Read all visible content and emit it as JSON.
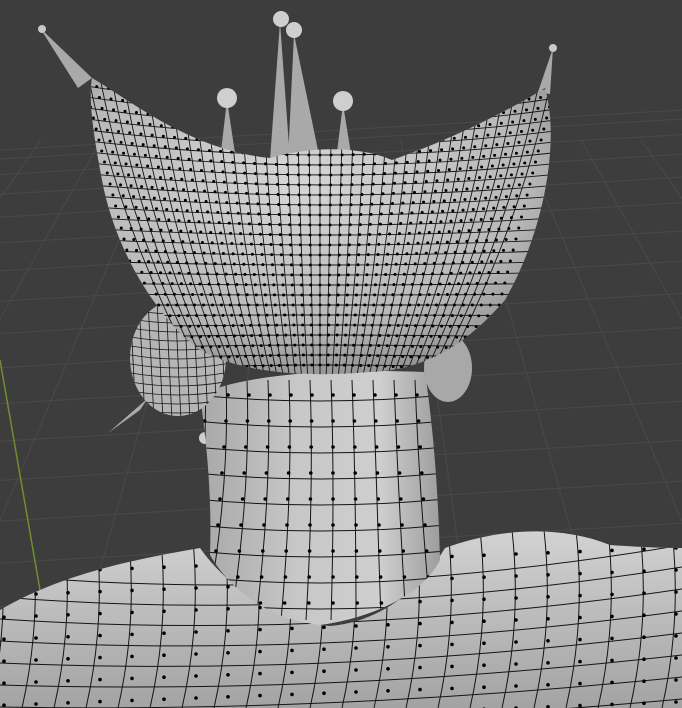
{
  "viewport": {
    "mode": "edit-mode",
    "background_color": "#3d3d3d",
    "grid_color": "#4a4a4a",
    "y_axis_color": "#6f8f2c",
    "mesh_fill_color": "#bdbdbd",
    "wire_color": "#141414",
    "vertex_color": "#000000",
    "bone_color": "#a9a9a9",
    "bone_joint_color": "#c8c8c8"
  },
  "objects": [
    {
      "name": "head-mesh",
      "kind": "mesh"
    },
    {
      "name": "neck-mesh",
      "kind": "mesh"
    },
    {
      "name": "shoulders-mesh",
      "kind": "mesh"
    },
    {
      "name": "armature",
      "kind": "bones"
    }
  ]
}
